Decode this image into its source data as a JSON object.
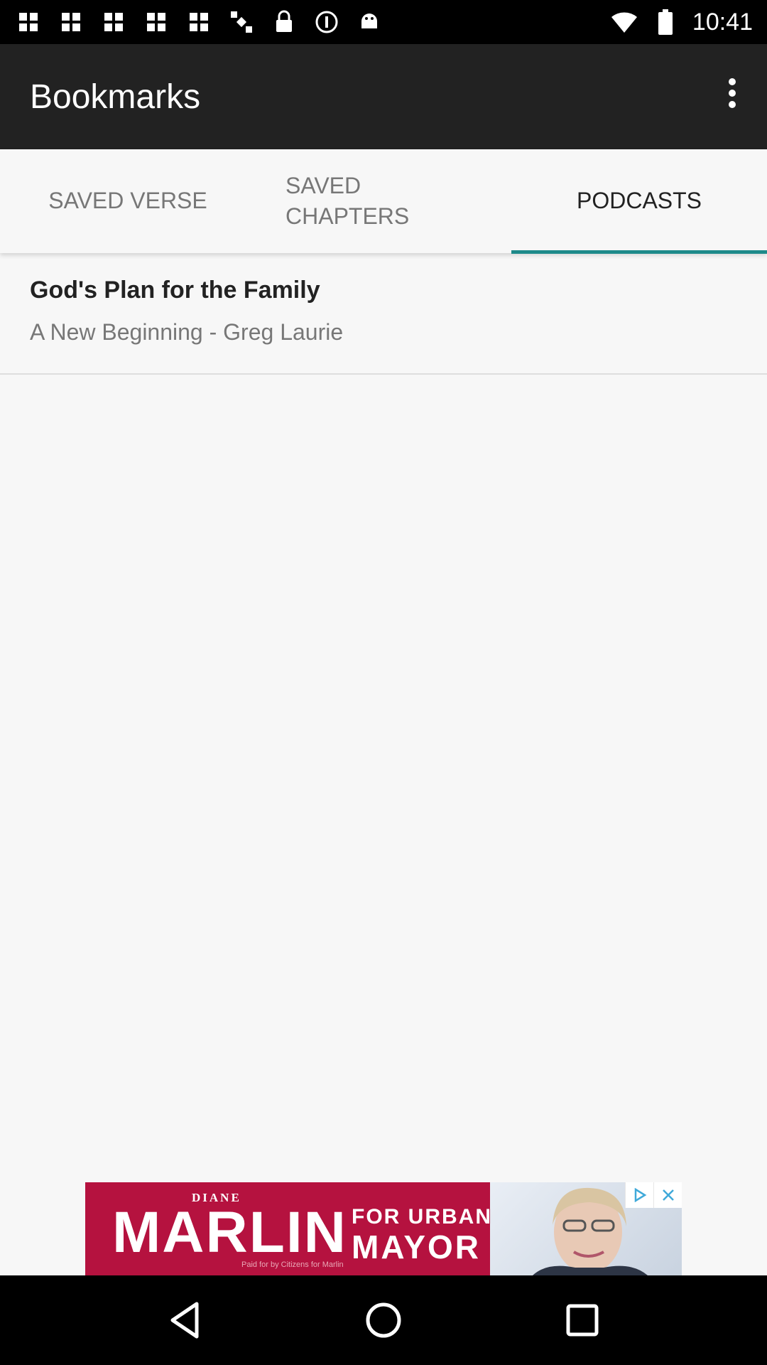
{
  "status_bar": {
    "time": "10:41",
    "icons": [
      "grid-icon",
      "grid-icon",
      "grid-icon",
      "grid-icon",
      "grid-icon",
      "satellite-icon",
      "lock-icon",
      "info-icon",
      "android-icon",
      "wifi-icon",
      "battery-icon"
    ]
  },
  "app_bar": {
    "title": "Bookmarks"
  },
  "tabs": [
    {
      "label": "SAVED VERSE",
      "active": false
    },
    {
      "label": "SAVED\nCHAPTERS",
      "active": false
    },
    {
      "label": "PODCASTS",
      "active": true
    }
  ],
  "podcasts": [
    {
      "title": "God's Plan for the Family",
      "subtitle": "A New Beginning - Greg Laurie"
    }
  ],
  "ad": {
    "line_top": "DIANE",
    "name": "MARLIN",
    "for": "FOR URBANA",
    "office": "MAYOR",
    "fine_print": "Paid for by Citizens for Marlin"
  },
  "colors": {
    "app_bar": "#222222",
    "accent": "#1e8a8a",
    "ad_background": "#b5123f"
  }
}
